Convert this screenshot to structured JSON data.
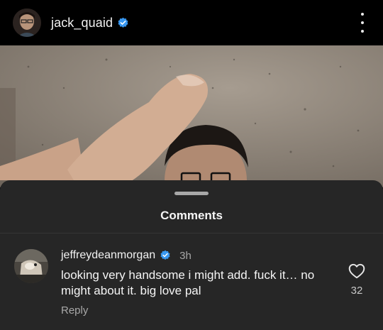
{
  "post": {
    "username": "jack_quaid",
    "verified_icon": "verified-badge-icon",
    "more_icon": "more-options-icon"
  },
  "comments_sheet": {
    "title": "Comments",
    "comments": [
      {
        "username": "jeffreydeanmorgan",
        "time": "3h",
        "text": "looking very handsome i might add. fuck it… no might about it. big love pal",
        "reply_label": "Reply",
        "like_count": "32",
        "like_icon": "heart-outline-icon"
      }
    ]
  },
  "colors": {
    "accent": "#3897f0",
    "sheet_bg": "#262626",
    "secondary_text": "#a8a8a8"
  }
}
